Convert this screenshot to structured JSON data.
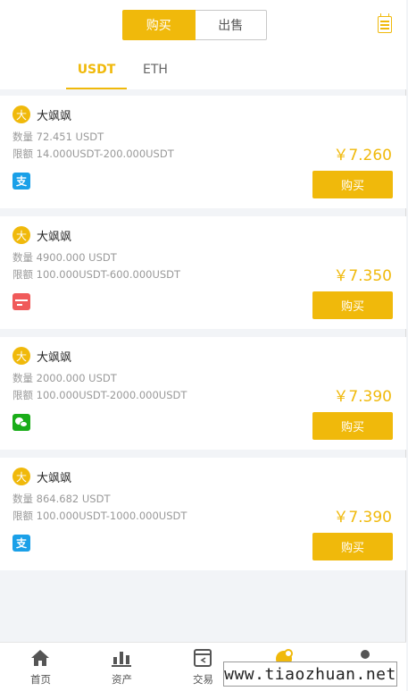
{
  "header": {
    "segments": [
      "购买",
      "出售"
    ],
    "active_segment": 0
  },
  "tabs": [
    "USDT",
    "ETH"
  ],
  "labels": {
    "quantity_prefix": "数量",
    "limit_prefix": "限额",
    "buy_button": "购买"
  },
  "orders": [
    {
      "avatar": "大",
      "name": "大飒飒",
      "quantity": "72.451 USDT",
      "limit": "14.000USDT-200.000USDT",
      "price": "￥7.260",
      "payment": "alipay-icon"
    },
    {
      "avatar": "大",
      "name": "大飒飒",
      "quantity": "4900.000 USDT",
      "limit": "100.000USDT-600.000USDT",
      "price": "￥7.350",
      "payment": "bank-card-icon"
    },
    {
      "avatar": "大",
      "name": "大飒飒",
      "quantity": "2000.000 USDT",
      "limit": "100.000USDT-2000.000USDT",
      "price": "￥7.390",
      "payment": "wechat-icon"
    },
    {
      "avatar": "大",
      "name": "大飒飒",
      "quantity": "864.682 USDT",
      "limit": "100.000USDT-1000.000USDT",
      "price": "￥7.390",
      "payment": "alipay-icon"
    }
  ],
  "bottom_nav": [
    "首页",
    "资产",
    "交易"
  ],
  "watermark": "www.tiaozhuan.net",
  "colors": {
    "accent": "#f0b90b",
    "alipay": "#1aa0e8",
    "bank": "#f05a5a",
    "wechat": "#1aad19"
  }
}
